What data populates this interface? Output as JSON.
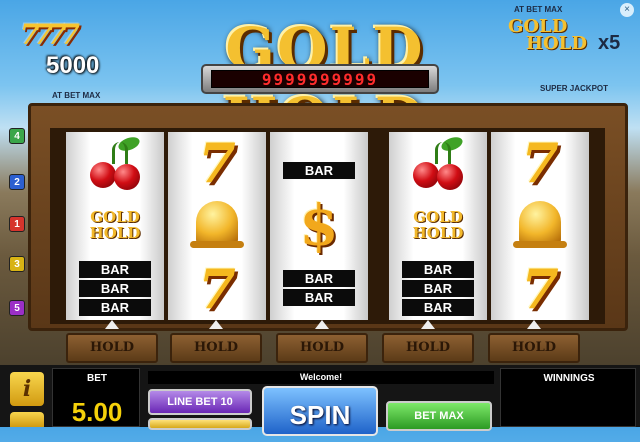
{
  "header": {
    "close_icon": "×",
    "left_jackpot": {
      "symbol": "7777",
      "value": "5000",
      "caption": "AT BET MAX"
    },
    "logo": "GOLD HOLD",
    "counter": "9999999999",
    "right_jackpot": {
      "caption_top": "AT BET MAX",
      "logo_line1": "GOLD",
      "logo_line2": "HOLD",
      "multiplier": "x5",
      "caption_bottom": "SUPER JACKPOT"
    }
  },
  "paylines": [
    {
      "label": "4",
      "color": "#3aa64a"
    },
    {
      "label": "2",
      "color": "#2c5fd0"
    },
    {
      "label": "1",
      "color": "#d6342c"
    },
    {
      "label": "3",
      "color": "#d8b314"
    },
    {
      "label": "5",
      "color": "#9b2fc7"
    }
  ],
  "reels": [
    {
      "symbols": [
        {
          "type": "cherry",
          "icon": "cherry-icon"
        },
        {
          "type": "logo",
          "text": "GOLD HOLD"
        },
        {
          "type": "bar",
          "bars": [
            "BAR",
            "BAR",
            "BAR"
          ]
        }
      ]
    },
    {
      "symbols": [
        {
          "type": "seven",
          "text": "7"
        },
        {
          "type": "bell",
          "icon": "bell-icon"
        },
        {
          "type": "seven",
          "text": "7"
        }
      ]
    },
    {
      "symbols": [
        {
          "type": "bar",
          "bars": [
            "BAR"
          ]
        },
        {
          "type": "dollar",
          "text": "$"
        },
        {
          "type": "bar",
          "bars": [
            "BAR",
            "BAR"
          ]
        }
      ]
    },
    {
      "symbols": [
        {
          "type": "cherry",
          "icon": "cherry-icon"
        },
        {
          "type": "logo",
          "text": "GOLD HOLD"
        },
        {
          "type": "bar",
          "bars": [
            "BAR",
            "BAR",
            "BAR"
          ]
        }
      ]
    },
    {
      "symbols": [
        {
          "type": "seven",
          "text": "7"
        },
        {
          "type": "bell",
          "icon": "bell-icon"
        },
        {
          "type": "seven",
          "text": "7"
        }
      ]
    }
  ],
  "hold_label": "HOLD",
  "controls": {
    "info_icon": "i",
    "bet_label": "BET",
    "bet_value": "5.00",
    "message": "Welcome!",
    "line_bet": "LINE BET 10",
    "spin": "SPIN",
    "bet_max": "BET MAX",
    "winnings_label": "WINNINGS"
  }
}
